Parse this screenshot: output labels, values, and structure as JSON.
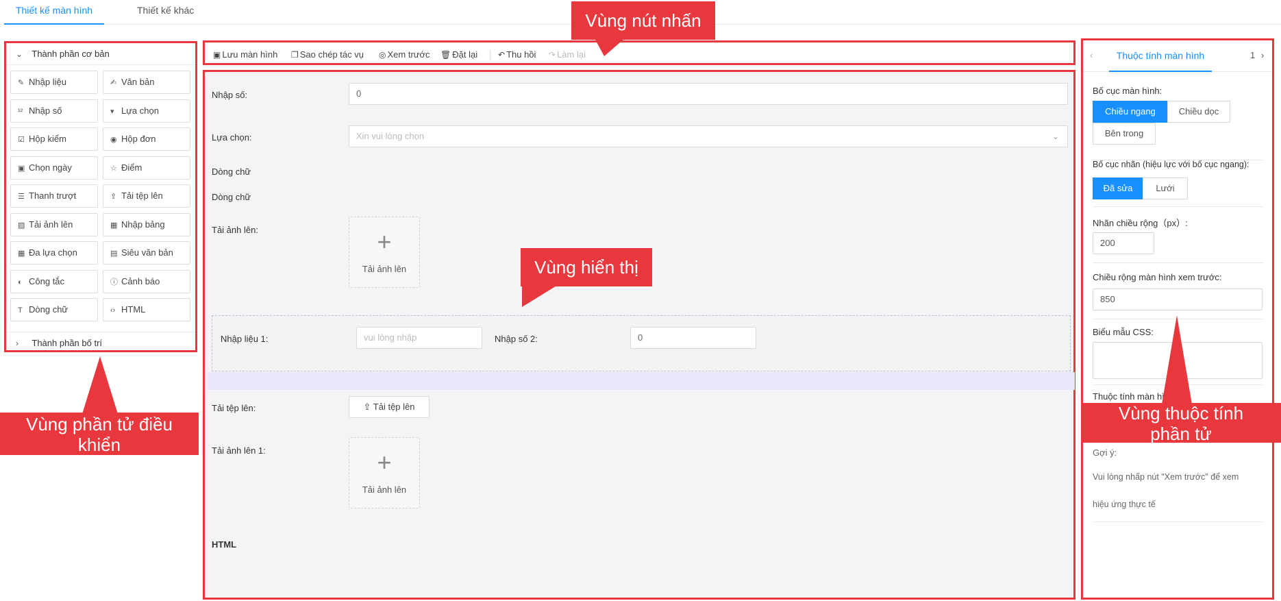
{
  "tabs": [
    {
      "label": "Thiết kế màn hình"
    },
    {
      "label": "Thiết kế khác"
    }
  ],
  "left_panel": {
    "basic_group": "Thành phần cơ bản",
    "layout_group": "Thành phần bố trí",
    "components": [
      {
        "label": "Nhập liệu",
        "icon": "pencil-icon",
        "glyph": "✎"
      },
      {
        "label": "Văn bản",
        "icon": "edit-text-icon",
        "glyph": "✍"
      },
      {
        "label": "Nhập số",
        "icon": "number-icon",
        "glyph": "¹²"
      },
      {
        "label": "Lựa chọn",
        "icon": "select-icon",
        "glyph": "▾"
      },
      {
        "label": "Hộp kiểm",
        "icon": "checkbox-icon",
        "glyph": "☑"
      },
      {
        "label": "Hộp đơn",
        "icon": "radio-icon",
        "glyph": "◉"
      },
      {
        "label": "Chọn ngày",
        "icon": "calendar-icon",
        "glyph": "▣"
      },
      {
        "label": "Điểm",
        "icon": "star-icon",
        "glyph": "☆"
      },
      {
        "label": "Thanh trượt",
        "icon": "slider-icon",
        "glyph": "☰"
      },
      {
        "label": "Tải tệp lên",
        "icon": "upload-icon",
        "glyph": "⇪"
      },
      {
        "label": "Tải ảnh lên",
        "icon": "image-icon",
        "glyph": "▨"
      },
      {
        "label": "Nhập bảng",
        "icon": "table-icon",
        "glyph": "▦"
      },
      {
        "label": "Đa lựa chọn",
        "icon": "multiselect-icon",
        "glyph": "▦"
      },
      {
        "label": "Siêu văn bản",
        "icon": "rich-text-icon",
        "glyph": "▤"
      },
      {
        "label": "Công tắc",
        "icon": "switch-icon",
        "glyph": "◐"
      },
      {
        "label": "Cảnh báo",
        "icon": "alert-icon",
        "glyph": "ⓘ"
      },
      {
        "label": "Dòng chữ",
        "icon": "text-icon",
        "glyph": "T"
      },
      {
        "label": "HTML",
        "icon": "code-icon",
        "glyph": "‹›"
      }
    ]
  },
  "toolbar": {
    "save": "Lưu màn hình",
    "copy": "Sao chép tác vụ",
    "preview": "Xem trước",
    "reset": "Đặt lại",
    "undo": "Thu hồi",
    "redo": "Làm lại"
  },
  "canvas": {
    "number_label": "Nhập số:",
    "number_value": "0",
    "select_label": "Lựa chọn:",
    "select_placeholder": "Xin vui lòng chọn",
    "text_line_1": "Dòng chữ",
    "text_line_2": "Dòng chữ",
    "image_upload_label": "Tải ảnh lên:",
    "image_upload_text": "Tải ảnh lên",
    "input1_label": "Nhập liệu 1:",
    "input1_placeholder": "vui lòng nhập",
    "number2_label": "Nhập số 2:",
    "number2_value": "0",
    "file_upload_label": "Tải tệp lên:",
    "file_upload_button": "Tải tệp lên",
    "image_upload1_label": "Tải ảnh lên 1:",
    "image_upload1_text": "Tải ảnh lên",
    "html_label": "HTML"
  },
  "right_panel": {
    "tab": "Thuộc tính màn hình",
    "page_indicator": "1",
    "screen_layout_label": "Bố cục màn hình:",
    "layout_options": [
      "Chiều ngang",
      "Chiều dọc",
      "Bên trong"
    ],
    "label_layout_label": "Bố cục nhãn (hiệu lực với bố cục ngang):",
    "label_layout_options": [
      "Đã sửa",
      "Lưới"
    ],
    "label_width_label": "Nhãn chiều rộng（px）:",
    "label_width_value": "200",
    "preview_width_label": "Chiều rộng màn hình xem trước:",
    "preview_width_value": "850",
    "css_label": "Biểu mẫu CSS:",
    "screen_props_label": "Thuộc tính màn hình",
    "hint_title": "Gợi ý:",
    "hint_line1": "Vui lòng nhấp nút \"Xem trước\" để xem",
    "hint_line2": "hiệu ứng thực tế"
  },
  "annotations": {
    "buttons_area": "Vùng nút nhấn",
    "display_area": "Vùng hiển thị",
    "controls_area_line1": "Vùng phần tử điều",
    "controls_area_line2": "khiển",
    "props_area_line1": "Vùng thuộc tính",
    "props_area_line2": "phần tử"
  },
  "colors": {
    "accent": "#1890ff",
    "annotation_red": "#e8373d"
  }
}
